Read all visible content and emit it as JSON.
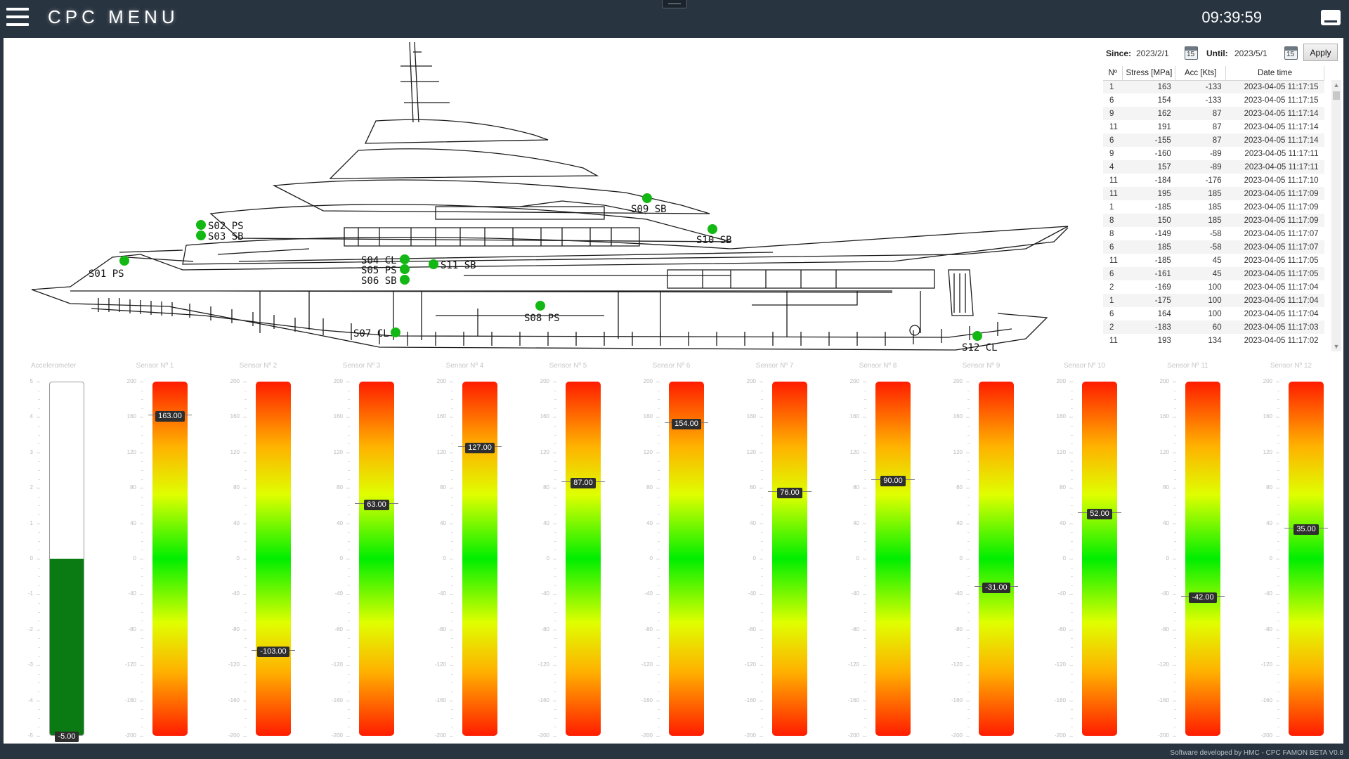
{
  "header": {
    "title": "CPC MENU",
    "clock": "09:39:59"
  },
  "filter": {
    "since_label": "Since:",
    "since_value": "2023/2/1",
    "until_label": "Until:",
    "until_value": "2023/5/1",
    "apply_label": "Apply",
    "calendar_icon_text": "15"
  },
  "table": {
    "headers": [
      "Nº",
      "Stress [MPa]",
      "Acc [Kts]",
      "Date time"
    ],
    "rows": [
      [
        "1",
        "163",
        "-133",
        "2023-04-05 11:17:15"
      ],
      [
        "6",
        "154",
        "-133",
        "2023-04-05 11:17:15"
      ],
      [
        "9",
        "162",
        "87",
        "2023-04-05 11:17:14"
      ],
      [
        "11",
        "191",
        "87",
        "2023-04-05 11:17:14"
      ],
      [
        "6",
        "-155",
        "87",
        "2023-04-05 11:17:14"
      ],
      [
        "9",
        "-160",
        "-89",
        "2023-04-05 11:17:11"
      ],
      [
        "4",
        "157",
        "-89",
        "2023-04-05 11:17:11"
      ],
      [
        "11",
        "-184",
        "-176",
        "2023-04-05 11:17:10"
      ],
      [
        "11",
        "195",
        "185",
        "2023-04-05 11:17:09"
      ],
      [
        "1",
        "-185",
        "185",
        "2023-04-05 11:17:09"
      ],
      [
        "8",
        "150",
        "185",
        "2023-04-05 11:17:09"
      ],
      [
        "8",
        "-149",
        "-58",
        "2023-04-05 11:17:07"
      ],
      [
        "6",
        "185",
        "-58",
        "2023-04-05 11:17:07"
      ],
      [
        "11",
        "-185",
        "45",
        "2023-04-05 11:17:05"
      ],
      [
        "6",
        "-161",
        "45",
        "2023-04-05 11:17:05"
      ],
      [
        "2",
        "-169",
        "100",
        "2023-04-05 11:17:04"
      ],
      [
        "1",
        "-175",
        "100",
        "2023-04-05 11:17:04"
      ],
      [
        "6",
        "164",
        "100",
        "2023-04-05 11:17:04"
      ],
      [
        "2",
        "-183",
        "60",
        "2023-04-05 11:17:03"
      ],
      [
        "11",
        "193",
        "134",
        "2023-04-05 11:17:02"
      ]
    ]
  },
  "sensors_on_drawing": [
    {
      "id": "s01",
      "label": "S01 PS"
    },
    {
      "id": "s02",
      "label": "S02 PS"
    },
    {
      "id": "s03",
      "label": "S03 SB"
    },
    {
      "id": "s04",
      "label": "S04 CL"
    },
    {
      "id": "s05",
      "label": "S05 PS"
    },
    {
      "id": "s06",
      "label": "S06 SB"
    },
    {
      "id": "s07",
      "label": "S07 CL"
    },
    {
      "id": "s08",
      "label": "S08 PS"
    },
    {
      "id": "s09",
      "label": "S09 SB"
    },
    {
      "id": "s10",
      "label": "S10 SB"
    },
    {
      "id": "s11",
      "label": "S11 SB"
    },
    {
      "id": "s12",
      "label": "S12 CL"
    }
  ],
  "sensor_marker_color": "#14b814",
  "accelerometer": {
    "title": "Accelerometer",
    "value": -5.0,
    "value_label": "-5.00",
    "scale": [
      5,
      4,
      3,
      2,
      1,
      0,
      -1,
      -2,
      -3,
      -4,
      -5
    ],
    "fill_color": "#0a7a12"
  },
  "stress_scale": [
    200,
    160,
    120,
    80,
    40,
    0,
    -40,
    -80,
    -120,
    -160,
    -200
  ],
  "stress_gauges": [
    {
      "title": "Sensor Nº 1",
      "value": 163,
      "label": "163.00"
    },
    {
      "title": "Sensor Nº 2",
      "value": -103,
      "label": "-103.00"
    },
    {
      "title": "Sensor Nº 3",
      "value": 63,
      "label": "63.00"
    },
    {
      "title": "Sensor Nº 4",
      "value": 127,
      "label": "127.00"
    },
    {
      "title": "Sensor Nº 5",
      "value": 87,
      "label": "87.00"
    },
    {
      "title": "Sensor Nº 6",
      "value": 154,
      "label": "154.00"
    },
    {
      "title": "Sensor Nº 7",
      "value": 76,
      "label": "76.00"
    },
    {
      "title": "Sensor Nº 8",
      "value": 90,
      "label": "90.00"
    },
    {
      "title": "Sensor Nº 9",
      "value": -31,
      "label": "-31.00"
    },
    {
      "title": "Sensor Nº 10",
      "value": 52,
      "label": "52.00"
    },
    {
      "title": "Sensor Nº 11",
      "value": -42,
      "label": "-42.00"
    },
    {
      "title": "Sensor Nº 12",
      "value": 35,
      "label": "35.00"
    }
  ],
  "footer": "Software developed by HMC - CPC FAMON BETA V0.8"
}
